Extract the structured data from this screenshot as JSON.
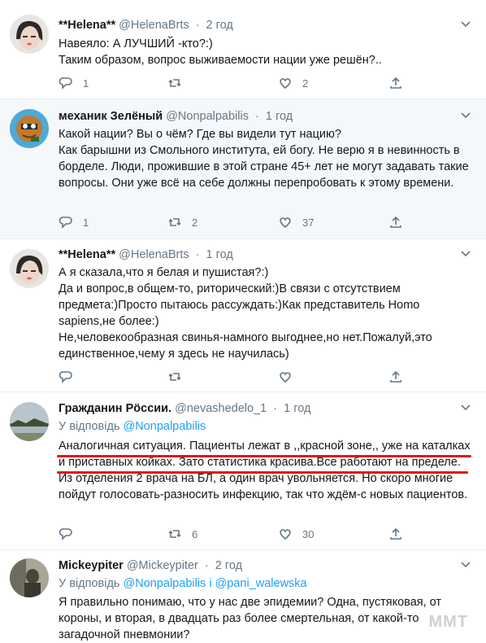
{
  "tweets": [
    {
      "name": "**Helena**",
      "handle": "@HelenaBrts",
      "time": "2 год",
      "body": "Навеяло: А ЛУЧШИЙ -кто?:)\nТаким образом, вопрос выживаемости нации уже решён?..",
      "replies": "1",
      "retweets": "",
      "likes": "2"
    },
    {
      "name": "механик Зелёный",
      "handle": "@Nonpalpabilis",
      "time": "1 год",
      "body": "Какой нации? Вы о чём? Где вы видели тут нацию?\nКак барышни из Смольного института, ей богу. Не верю я в невинность в борделе. Люди, прожившие в этой стране 45+ лет не могут задавать такие вопросы. Они уже всё на себе должны перепробовать к этому времени.",
      "replies": "1",
      "retweets": "2",
      "likes": "37"
    },
    {
      "name": "**Helena**",
      "handle": "@HelenaBrts",
      "time": "1 год",
      "body": "А я сказала,что я белая и пушистая?:)\nДа и вопрос,в общем-то, риторический:)В связи с отсутствием предмета:)Просто пытаюсь рассуждать:)Как представитель Homo sapiens,не более:)\nНе,человекообразная свинья-намного выгоднее,но нет.Пожалуй,это единственное,чему я здесь не научилась)",
      "replies": "",
      "retweets": "",
      "likes": ""
    },
    {
      "name": "Гражданин Рöссии.",
      "handle": "@nevashedelo_1",
      "time": "1 год",
      "reply_prefix": "У відповідь ",
      "reply_handles": "@Nonpalpabilis",
      "body": "Аналогичная ситуация. Пациенты лежат в ,,красной зоне,, уже на каталках и приставных койках. Зато статистика красива.Все работают на пределе. Из отделения 2 врача на БЛ, а один врач увольняется. Но скоро многие пойдут голосовать-разносить инфекцию, так что ждём-с новых пациентов.",
      "replies": "",
      "retweets": "6",
      "likes": "30"
    },
    {
      "name": "Mickeypiter",
      "handle": "@Mickeypiter",
      "time": "2 год",
      "reply_prefix": "У відповідь ",
      "reply_handles": "@Nonpalpabilis і @pani_walewska",
      "body": "Я правильно понимаю, что у нас две эпидемии? Одна, пустяковая, от короны, и вторая, в двадцать раз более смертельная, от какой-то загадочной пневмонии?",
      "replies": "",
      "retweets": "",
      "likes": ""
    }
  ],
  "watermark": "MMT",
  "colors": {
    "highlight": "#f5f8fa",
    "link": "#1da1f2",
    "muted": "#657786",
    "underline": "#e0131d"
  }
}
